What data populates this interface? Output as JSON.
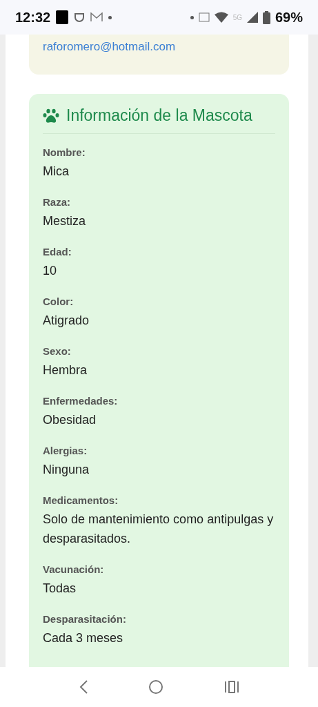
{
  "status_bar": {
    "time": "12:32",
    "battery": "69%",
    "network": "5G"
  },
  "owner_card": {
    "email": "raforomero@hotmail.com"
  },
  "pet_card": {
    "title": "Información de la Mascota",
    "fields": [
      {
        "label": "Nombre:",
        "value": "Mica"
      },
      {
        "label": "Raza:",
        "value": "Mestiza"
      },
      {
        "label": "Edad:",
        "value": "10"
      },
      {
        "label": "Color:",
        "value": "Atigrado"
      },
      {
        "label": "Sexo:",
        "value": "Hembra"
      },
      {
        "label": "Enfermedades:",
        "value": "Obesidad"
      },
      {
        "label": "Alergias:",
        "value": "Ninguna"
      },
      {
        "label": "Medicamentos:",
        "value": "Solo de mantenimiento como antipulgas y desparasitados."
      },
      {
        "label": "Vacunación:",
        "value": "Todas"
      },
      {
        "label": "Desparasitación:",
        "value": "Cada 3 meses"
      }
    ]
  }
}
